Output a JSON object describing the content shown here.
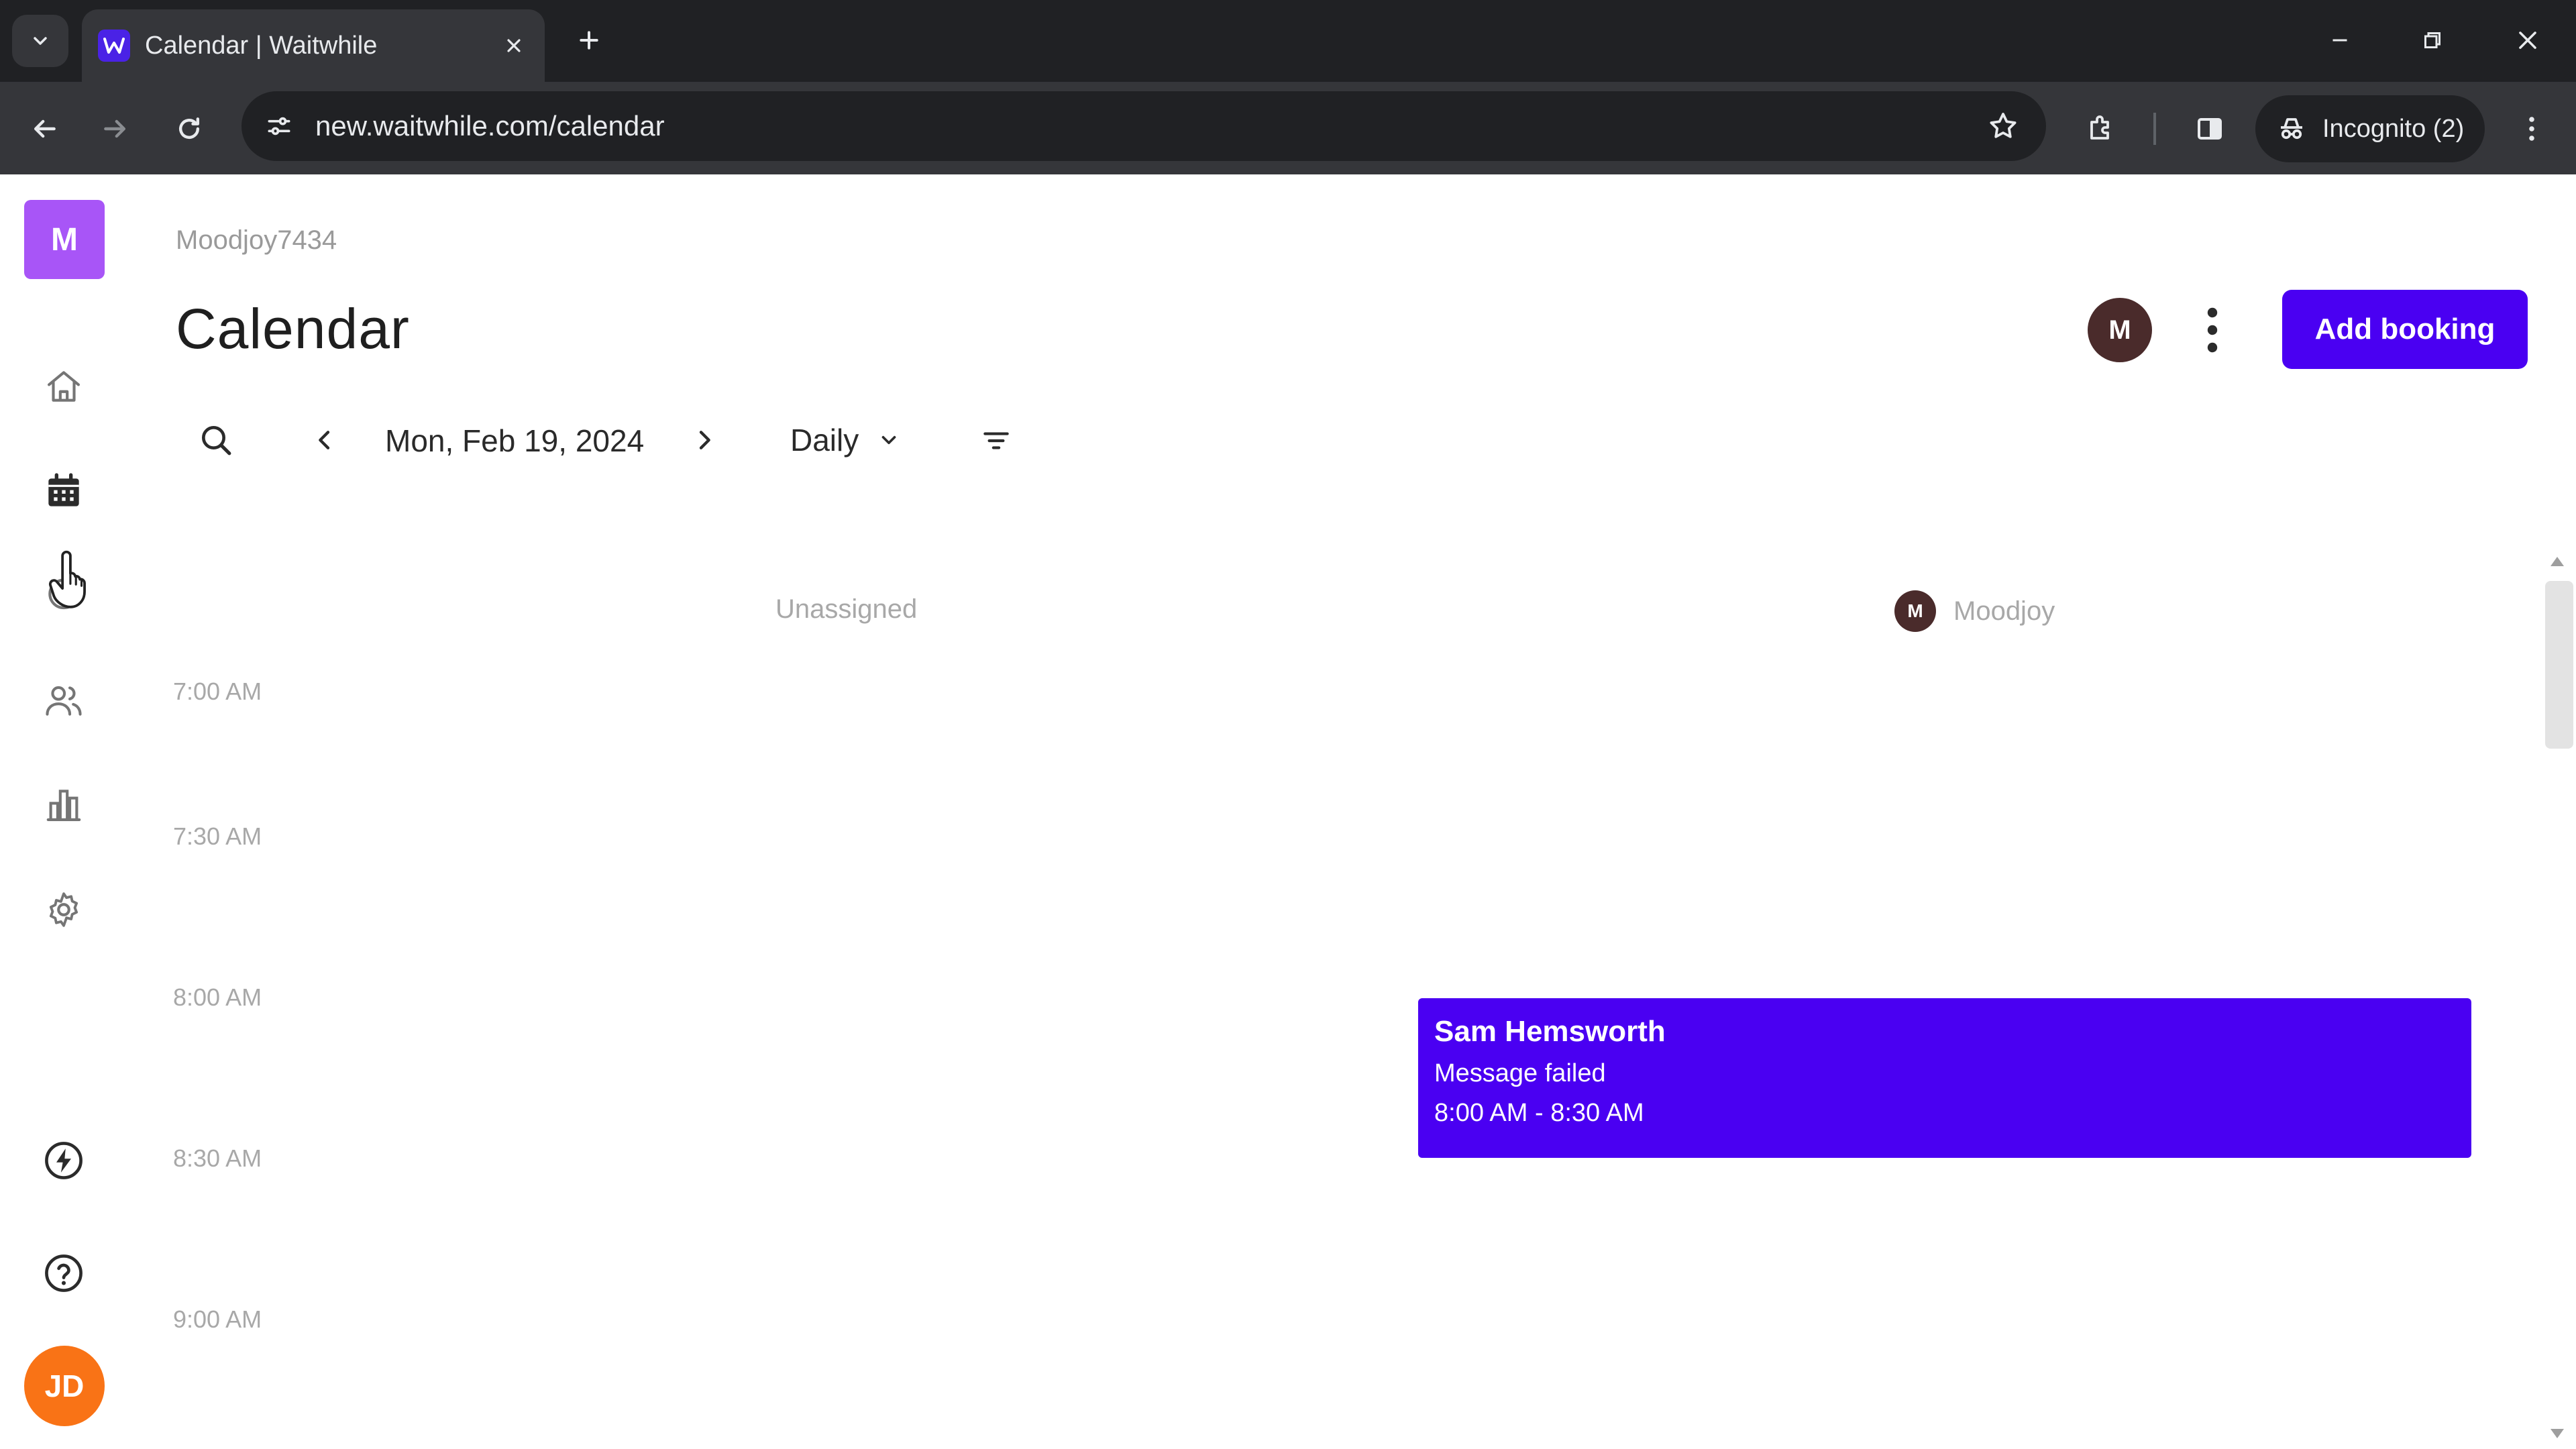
{
  "browser": {
    "tab_title": "Calendar | Waitwhile",
    "url": "new.waitwhile.com/calendar",
    "incognito_label": "Incognito (2)"
  },
  "sidebar": {
    "org_initial": "M",
    "user_initials": "JD",
    "items": [
      {
        "name": "home-icon"
      },
      {
        "name": "calendar-icon",
        "active": true
      },
      {
        "name": "waitlist-icon"
      },
      {
        "name": "customers-icon"
      },
      {
        "name": "analytics-icon"
      },
      {
        "name": "settings-icon"
      },
      {
        "name": "bolt-icon"
      },
      {
        "name": "help-icon"
      }
    ]
  },
  "header": {
    "org_name": "Moodjoy7434",
    "title": "Calendar",
    "avatar_initial": "M",
    "add_booking_label": "Add booking"
  },
  "controls": {
    "date": "Mon, Feb 19, 2024",
    "view": "Daily"
  },
  "columns": {
    "unassigned": "Unassigned",
    "resource_initial": "M",
    "resource_name": "Moodjoy"
  },
  "times": [
    "7:00 AM",
    "7:30 AM",
    "8:00 AM",
    "8:30 AM",
    "9:00 AM"
  ],
  "booking": {
    "name": "Sam Hemsworth",
    "status": "Message failed",
    "time": "8:00 AM - 8:30 AM"
  },
  "colors": {
    "brand": "#4a00f2",
    "org_tile": "#a855f7",
    "user_avatar": "#f97316",
    "resource_avatar": "#4a2b2b"
  }
}
